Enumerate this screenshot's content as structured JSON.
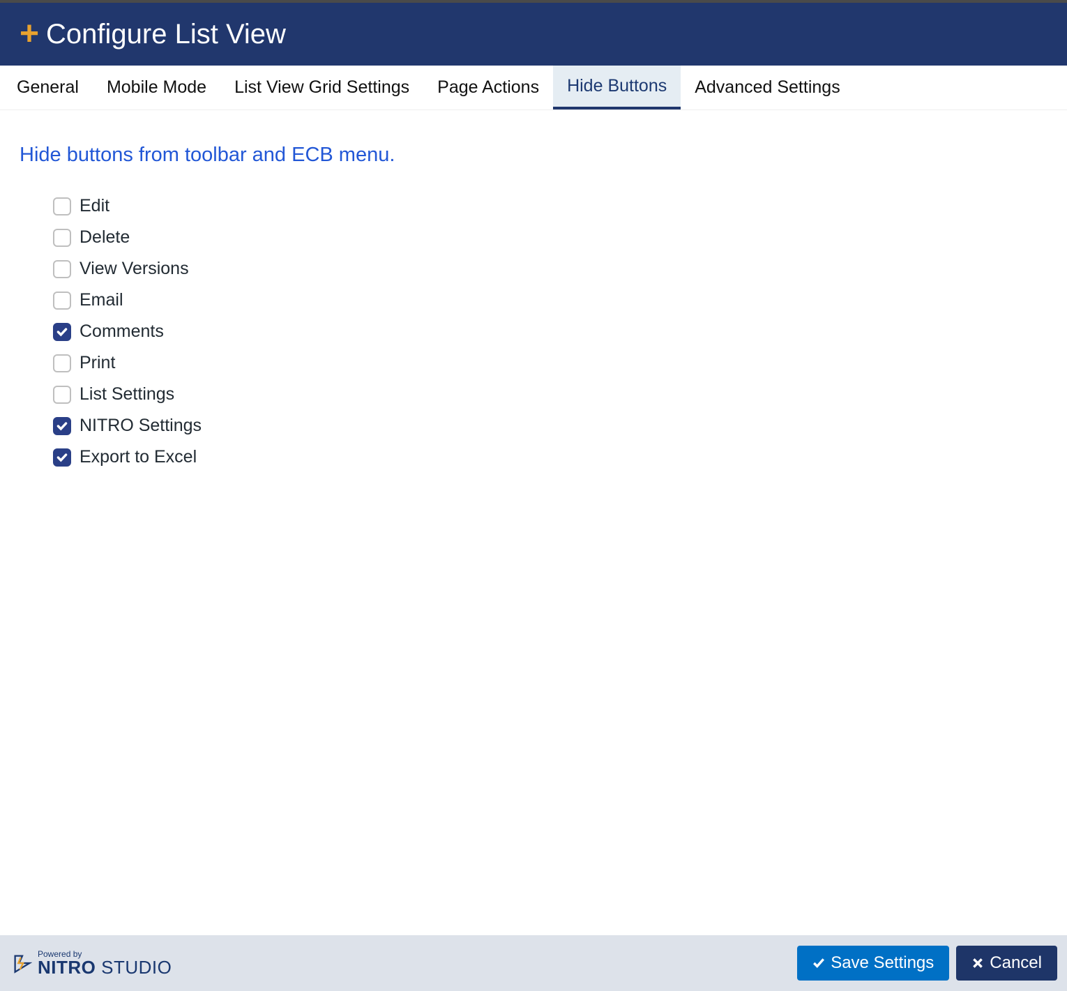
{
  "header": {
    "title": "Configure List View"
  },
  "tabs": [
    {
      "label": "General",
      "active": false
    },
    {
      "label": "Mobile Mode",
      "active": false
    },
    {
      "label": "List View Grid Settings",
      "active": false
    },
    {
      "label": "Page Actions",
      "active": false
    },
    {
      "label": "Hide Buttons",
      "active": true
    },
    {
      "label": "Advanced Settings",
      "active": false
    }
  ],
  "section": {
    "heading": "Hide buttons from toolbar and ECB menu."
  },
  "options": [
    {
      "label": "Edit",
      "checked": false
    },
    {
      "label": "Delete",
      "checked": false
    },
    {
      "label": "View Versions",
      "checked": false
    },
    {
      "label": "Email",
      "checked": false
    },
    {
      "label": "Comments",
      "checked": true
    },
    {
      "label": "Print",
      "checked": false
    },
    {
      "label": "List Settings",
      "checked": false
    },
    {
      "label": "NITRO Settings",
      "checked": true
    },
    {
      "label": "Export to Excel",
      "checked": true
    }
  ],
  "footer": {
    "powered_by": "Powered by",
    "brand_bold": "NITRO",
    "brand_light": " STUDIO",
    "save_label": "Save Settings",
    "cancel_label": "Cancel"
  }
}
